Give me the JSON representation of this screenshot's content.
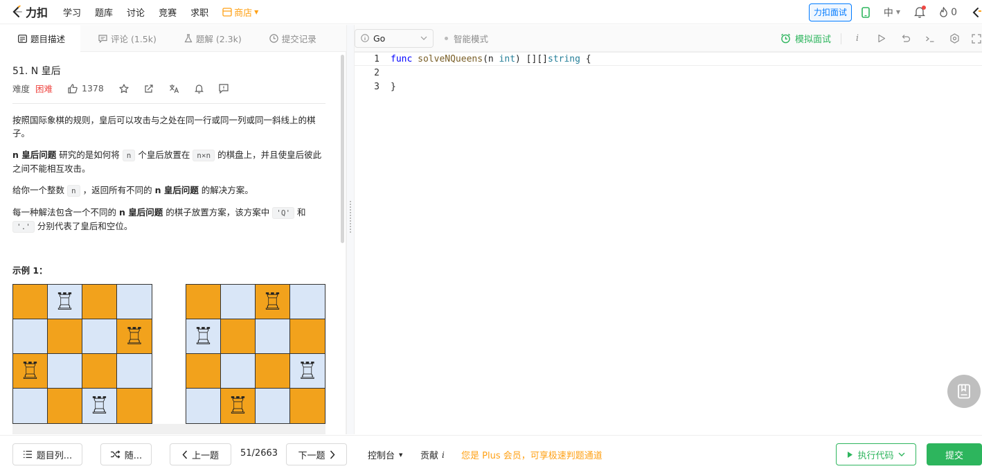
{
  "nav": {
    "logo_text": "力扣",
    "links": [
      "学习",
      "题库",
      "讨论",
      "竞赛",
      "求职"
    ],
    "shop_label": "商店",
    "interview_button": "力扣面试",
    "lang_label": "中",
    "points": "0",
    "brand_color": "#ffa116"
  },
  "left_tabs": [
    {
      "label": "题目描述",
      "icon": "document-icon",
      "active": true
    },
    {
      "label": "评论 (1.5k)",
      "icon": "comment-icon",
      "active": false
    },
    {
      "label": "题解 (2.3k)",
      "icon": "flask-icon",
      "active": false
    },
    {
      "label": "提交记录",
      "icon": "history-icon",
      "active": false
    }
  ],
  "problem": {
    "title": "51. N 皇后",
    "difficulty_label": "难度",
    "difficulty": "困难",
    "likes": "1378",
    "para1": "按照国际象棋的规则，皇后可以攻击与之处在同一行或同一列或同一斜线上的棋子。",
    "para2_bold": "n 皇后问题",
    "para2_a": " 研究的是如何将 ",
    "para2_code1": "n",
    "para2_b": " 个皇后放置在 ",
    "para2_code2": "n×n",
    "para2_c": " 的棋盘上，并且使皇后彼此之间不能相互攻击。",
    "para3_a": "给你一个整数 ",
    "para3_code": "n",
    "para3_b": " ，返回所有不同的 ",
    "para3_bold": "n 皇后问题",
    "para3_c": " 的解决方案。",
    "para4_a": "每一种解法包含一个不同的 ",
    "para4_bold": "n 皇后问题",
    "para4_b": " 的棋子放置方案，该方案中 ",
    "para4_code1": "'Q'",
    "para4_c": " 和 ",
    "para4_code2": "'.'",
    "para4_d": " 分别代表了皇后和空位。",
    "example_title": "示例 1：",
    "board_colors": {
      "orange": "#f2a21c",
      "blue": "#d9e6f7"
    },
    "boards": [
      [
        "oQob",
        "booQ",
        "Qbob",
        "boQo"
      ],
      [
        "obQb",
        "Qobo",
        "oboQ",
        "bQbo"
      ]
    ]
  },
  "editor": {
    "language": "Go",
    "smart_mode": "智能模式",
    "mock_interview": "模拟面试",
    "lines": [
      {
        "num": "1",
        "tokens": [
          [
            "kw",
            "func"
          ],
          [
            "",
            " "
          ],
          [
            "fn",
            "solveNQueens"
          ],
          [
            "",
            "(n "
          ],
          [
            "ty",
            "int"
          ],
          [
            "",
            ") [][]"
          ],
          [
            "ty",
            "string"
          ],
          [
            "",
            " {"
          ]
        ]
      },
      {
        "num": "2",
        "tokens": []
      },
      {
        "num": "3",
        "tokens": [
          [
            "",
            "}"
          ]
        ]
      }
    ]
  },
  "bottom": {
    "problem_list": "题目列...",
    "random": "随...",
    "prev": "上一题",
    "progress": "51/2663",
    "next": "下一题",
    "console": "控制台",
    "contribute": "贡献",
    "plus_note": "您是 Plus 会员，可享极速判题通道",
    "run": "执行代码",
    "submit": "提交"
  }
}
